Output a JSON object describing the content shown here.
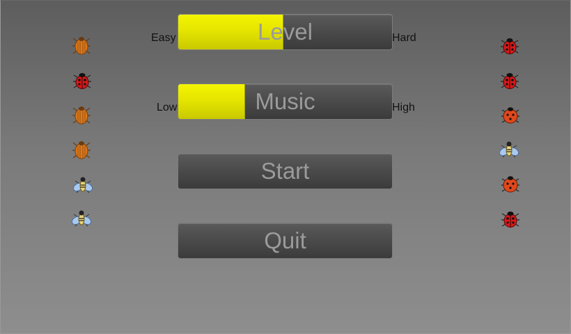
{
  "menu": {
    "level": {
      "label": "Level",
      "min_label": "Easy",
      "max_label": "Hard",
      "value_fraction": 0.49
    },
    "music": {
      "label": "Music",
      "min_label": "Low",
      "max_label": "High",
      "value_fraction": 0.31
    },
    "start_label": "Start",
    "quit_label": "Quit"
  },
  "colors": {
    "slider_fill": "#ecec00",
    "button_bg": "#4a4a4a",
    "button_text": "#9b9b9b"
  },
  "decorations": {
    "left_column": [
      "beetle-icon",
      "ladybug-icon",
      "beetle-icon",
      "beetle-icon",
      "fly-icon",
      "fly-icon"
    ],
    "right_column": [
      "ladybug-icon",
      "ladybug-icon",
      "ladybug-icon",
      "fly-icon",
      "ladybug-icon",
      "ladybug-icon"
    ]
  }
}
